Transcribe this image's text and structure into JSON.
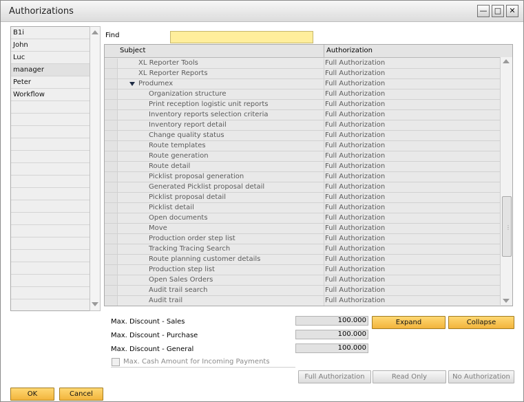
{
  "window": {
    "title": "Authorizations",
    "controls": {
      "minimize": "—",
      "maximize": "□",
      "close": "✕"
    }
  },
  "users": [
    "B1i",
    "John",
    "Luc",
    "manager",
    "Peter",
    "Workflow"
  ],
  "selected_user": "manager",
  "find": {
    "label": "Find",
    "value": ""
  },
  "grid": {
    "headers": {
      "subject": "Subject",
      "authorization": "Authorization"
    },
    "rows": [
      {
        "subject": "XL Reporter Tools",
        "auth": "Full Authorization",
        "level": 1
      },
      {
        "subject": "XL Reporter Reports",
        "auth": "Full Authorization",
        "level": 1
      },
      {
        "subject": "Produmex",
        "auth": "Full Authorization",
        "level": 1,
        "expanded": true
      },
      {
        "subject": "Organization structure",
        "auth": "Full Authorization",
        "level": 2
      },
      {
        "subject": "Print reception logistic unit reports",
        "auth": "Full Authorization",
        "level": 2
      },
      {
        "subject": "Inventory reports selection criteria",
        "auth": "Full Authorization",
        "level": 2
      },
      {
        "subject": "Inventory report detail",
        "auth": "Full Authorization",
        "level": 2
      },
      {
        "subject": "Change quality status",
        "auth": "Full Authorization",
        "level": 2
      },
      {
        "subject": "Route templates",
        "auth": "Full Authorization",
        "level": 2
      },
      {
        "subject": "Route generation",
        "auth": "Full Authorization",
        "level": 2
      },
      {
        "subject": "Route detail",
        "auth": "Full Authorization",
        "level": 2
      },
      {
        "subject": "Picklist proposal generation",
        "auth": "Full Authorization",
        "level": 2
      },
      {
        "subject": "Generated Picklist proposal detail",
        "auth": "Full Authorization",
        "level": 2
      },
      {
        "subject": "Picklist proposal detail",
        "auth": "Full Authorization",
        "level": 2
      },
      {
        "subject": "Picklist detail",
        "auth": "Full Authorization",
        "level": 2
      },
      {
        "subject": "Open documents",
        "auth": "Full Authorization",
        "level": 2
      },
      {
        "subject": "Move",
        "auth": "Full Authorization",
        "level": 2
      },
      {
        "subject": "Production order step list",
        "auth": "Full Authorization",
        "level": 2
      },
      {
        "subject": "Tracking Tracing Search",
        "auth": "Full Authorization",
        "level": 2
      },
      {
        "subject": "Route planning customer details",
        "auth": "Full Authorization",
        "level": 2
      },
      {
        "subject": "Production step list",
        "auth": "Full Authorization",
        "level": 2
      },
      {
        "subject": "Open Sales Orders",
        "auth": "Full Authorization",
        "level": 2
      },
      {
        "subject": "Audit trail search",
        "auth": "Full Authorization",
        "level": 2
      },
      {
        "subject": "Audit trail",
        "auth": "Full Authorization",
        "level": 2
      }
    ]
  },
  "discounts": {
    "sales": {
      "label": "Max. Discount - Sales",
      "value": "100.000"
    },
    "purchase": {
      "label": "Max. Discount - Purchase",
      "value": "100.000"
    },
    "general": {
      "label": "Max. Discount - General",
      "value": "100.000"
    }
  },
  "cash": {
    "label": "Max. Cash Amount for Incoming Payments",
    "checked": false
  },
  "buttons": {
    "expand": "Expand",
    "collapse": "Collapse",
    "full_auth": "Full Authorization",
    "read_only": "Read Only",
    "no_auth": "No Authorization",
    "ok": "OK",
    "cancel": "Cancel"
  }
}
